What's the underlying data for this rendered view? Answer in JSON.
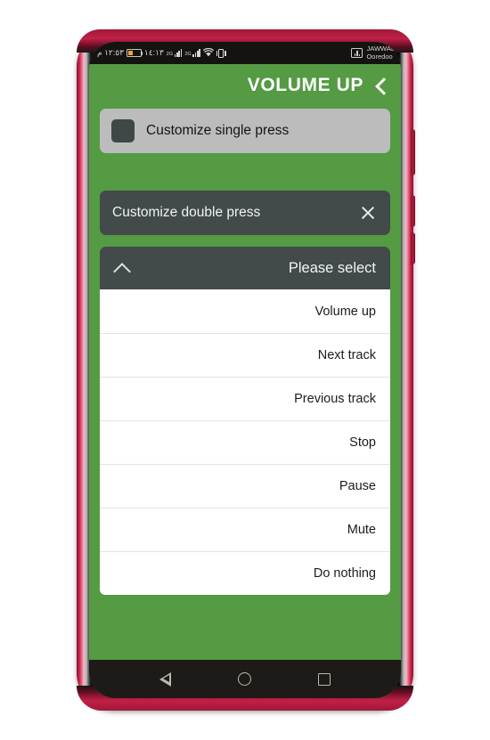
{
  "status_bar": {
    "time": "١٢:٥٣ م",
    "battery_icon": "battery-icon",
    "battery_percent": "١٤:١٣",
    "network_1_label": "2G",
    "network_2_label": "2G",
    "wifi_icon": "wifi-icon",
    "vibrate_icon": "vibrate-icon",
    "carrier_line1": "JAWWAL",
    "carrier_line2": "Ooredoo"
  },
  "header": {
    "title": "VOLUME UP",
    "back_icon": "chevron-left-icon"
  },
  "single_press": {
    "label": "Customize single press",
    "swatch_color": "#3f4747"
  },
  "double_press": {
    "label": "Customize double press",
    "close_icon": "close-icon"
  },
  "select": {
    "value": "Please select",
    "collapse_icon": "chevron-up-icon",
    "options": [
      {
        "label": "Volume up"
      },
      {
        "label": "Next track"
      },
      {
        "label": "Previous track"
      },
      {
        "label": "Stop"
      },
      {
        "label": "Pause"
      },
      {
        "label": "Mute"
      },
      {
        "label": "Do nothing"
      }
    ]
  },
  "nav_bar": {
    "back": "triangle-back-icon",
    "home": "circle-home-icon",
    "recents": "square-recents-icon"
  },
  "colors": {
    "app_green": "#549b43",
    "dark_slate": "#424a4a",
    "light_gray": "#bcbcbc",
    "white": "#ffffff",
    "frame_crimson": "#c22047"
  }
}
